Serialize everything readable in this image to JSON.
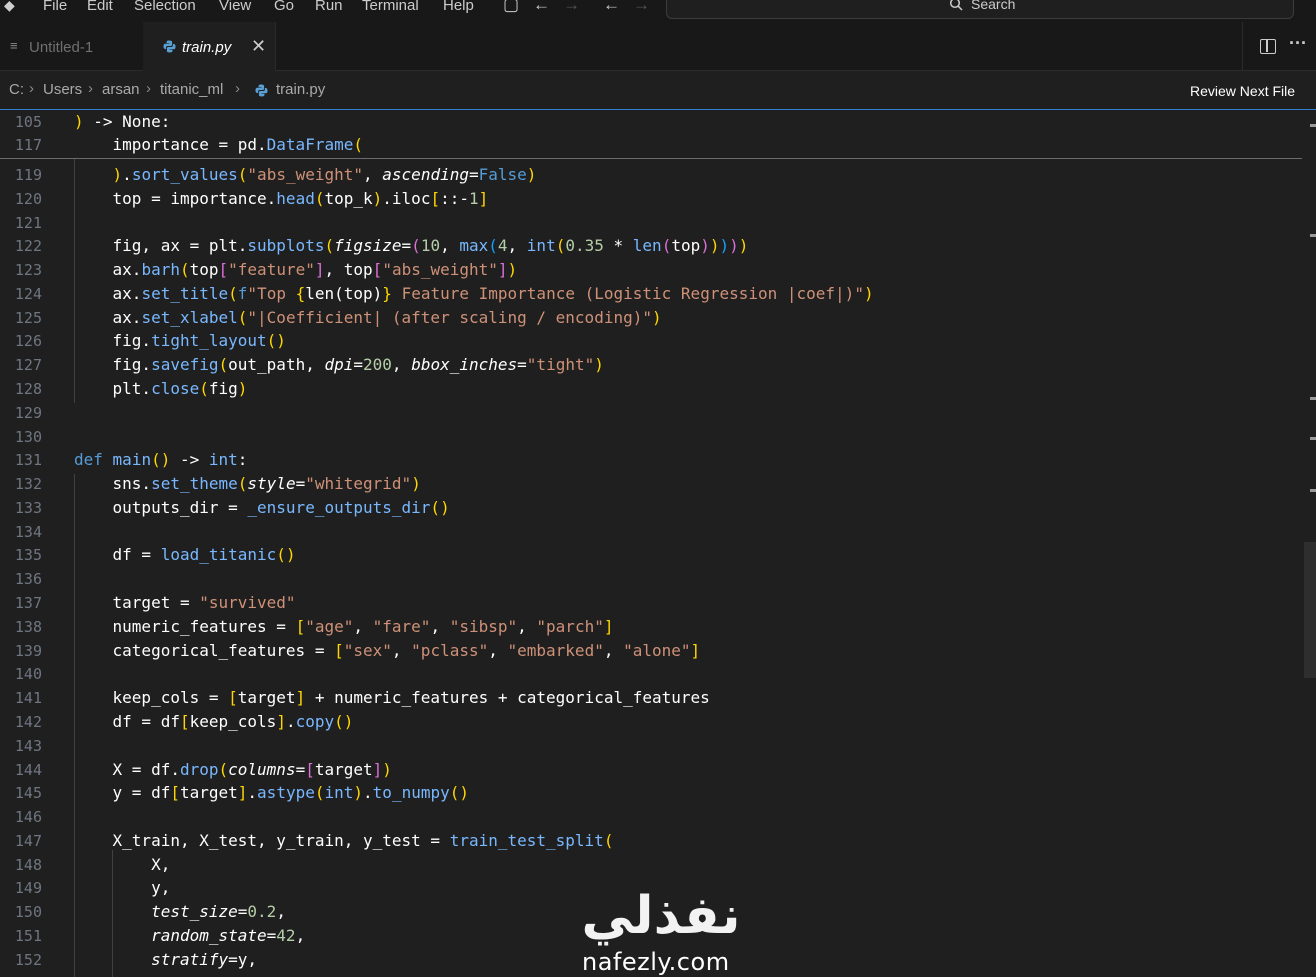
{
  "menu": [
    "File",
    "Edit",
    "Selection",
    "View",
    "Go",
    "Run",
    "Terminal",
    "Help"
  ],
  "search": {
    "label": "Search"
  },
  "tabs": [
    {
      "label": "Untitled-1",
      "active": false
    },
    {
      "label": "train.py",
      "active": true
    }
  ],
  "breadcrumb": {
    "drive": "C:",
    "parts": [
      "Users",
      "arsan",
      "titanic_ml"
    ],
    "file": "train.py"
  },
  "review_next_label": "Review Next File",
  "sticky_lines": [
    {
      "num": "105",
      "text": ") -> None:"
    },
    {
      "num": "117",
      "text": "    importance = pd.DataFrame("
    }
  ],
  "code_lines": [
    {
      "num": "119",
      "text": "    ).sort_values(\"abs_weight\", ascending=False)"
    },
    {
      "num": "120",
      "text": "    top = importance.head(top_k).iloc[::-1]"
    },
    {
      "num": "121",
      "text": ""
    },
    {
      "num": "122",
      "text": "    fig, ax = plt.subplots(figsize=(10, max(4, int(0.35 * len(top)))))"
    },
    {
      "num": "123",
      "text": "    ax.barh(top[\"feature\"], top[\"abs_weight\"])"
    },
    {
      "num": "124",
      "text": "    ax.set_title(f\"Top {len(top)} Feature Importance (Logistic Regression |coef|)\")"
    },
    {
      "num": "125",
      "text": "    ax.set_xlabel(\"|Coefficient| (after scaling / encoding)\")"
    },
    {
      "num": "126",
      "text": "    fig.tight_layout()"
    },
    {
      "num": "127",
      "text": "    fig.savefig(out_path, dpi=200, bbox_inches=\"tight\")"
    },
    {
      "num": "128",
      "text": "    plt.close(fig)"
    },
    {
      "num": "129",
      "text": ""
    },
    {
      "num": "130",
      "text": ""
    },
    {
      "num": "131",
      "text": "def main() -> int:"
    },
    {
      "num": "132",
      "text": "    sns.set_theme(style=\"whitegrid\")"
    },
    {
      "num": "133",
      "text": "    outputs_dir = _ensure_outputs_dir()"
    },
    {
      "num": "134",
      "text": ""
    },
    {
      "num": "135",
      "text": "    df = load_titanic()"
    },
    {
      "num": "136",
      "text": ""
    },
    {
      "num": "137",
      "text": "    target = \"survived\""
    },
    {
      "num": "138",
      "text": "    numeric_features = [\"age\", \"fare\", \"sibsp\", \"parch\"]"
    },
    {
      "num": "139",
      "text": "    categorical_features = [\"sex\", \"pclass\", \"embarked\", \"alone\"]"
    },
    {
      "num": "140",
      "text": ""
    },
    {
      "num": "141",
      "text": "    keep_cols = [target] + numeric_features + categorical_features"
    },
    {
      "num": "142",
      "text": "    df = df[keep_cols].copy()"
    },
    {
      "num": "143",
      "text": ""
    },
    {
      "num": "144",
      "text": "    X = df.drop(columns=[target])"
    },
    {
      "num": "145",
      "text": "    y = df[target].astype(int).to_numpy()"
    },
    {
      "num": "146",
      "text": ""
    },
    {
      "num": "147",
      "text": "    X_train, X_test, y_train, y_test = train_test_split("
    },
    {
      "num": "148",
      "text": "        X,"
    },
    {
      "num": "149",
      "text": "        y,"
    },
    {
      "num": "150",
      "text": "        test_size=0.2,"
    },
    {
      "num": "151",
      "text": "        random_state=42,"
    },
    {
      "num": "152",
      "text": "        stratify=y,"
    }
  ],
  "watermark": {
    "arabic": "نفذلي",
    "latin": "nafezly.com"
  }
}
